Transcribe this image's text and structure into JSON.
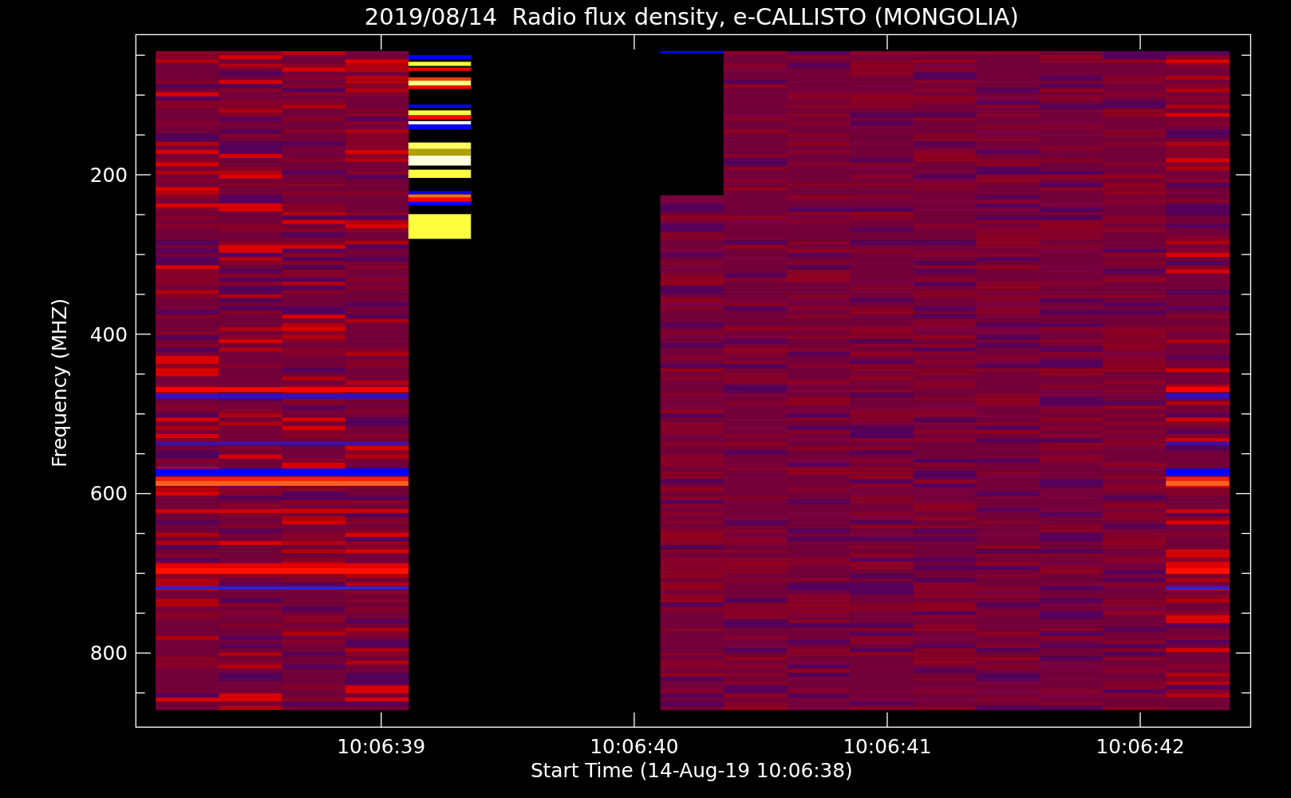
{
  "title": "2019/08/14  Radio flux density, e-CALLISTO (MONGOLIA)",
  "y_axis": {
    "label": "Frequency (MHZ)",
    "ticks": [
      "200",
      "400",
      "600",
      "800"
    ]
  },
  "x_axis": {
    "label": "Start Time (14-Aug-19 10:06:38)",
    "ticks": [
      "10:06:39",
      "10:06:40",
      "10:06:41",
      "10:06:42"
    ]
  }
}
